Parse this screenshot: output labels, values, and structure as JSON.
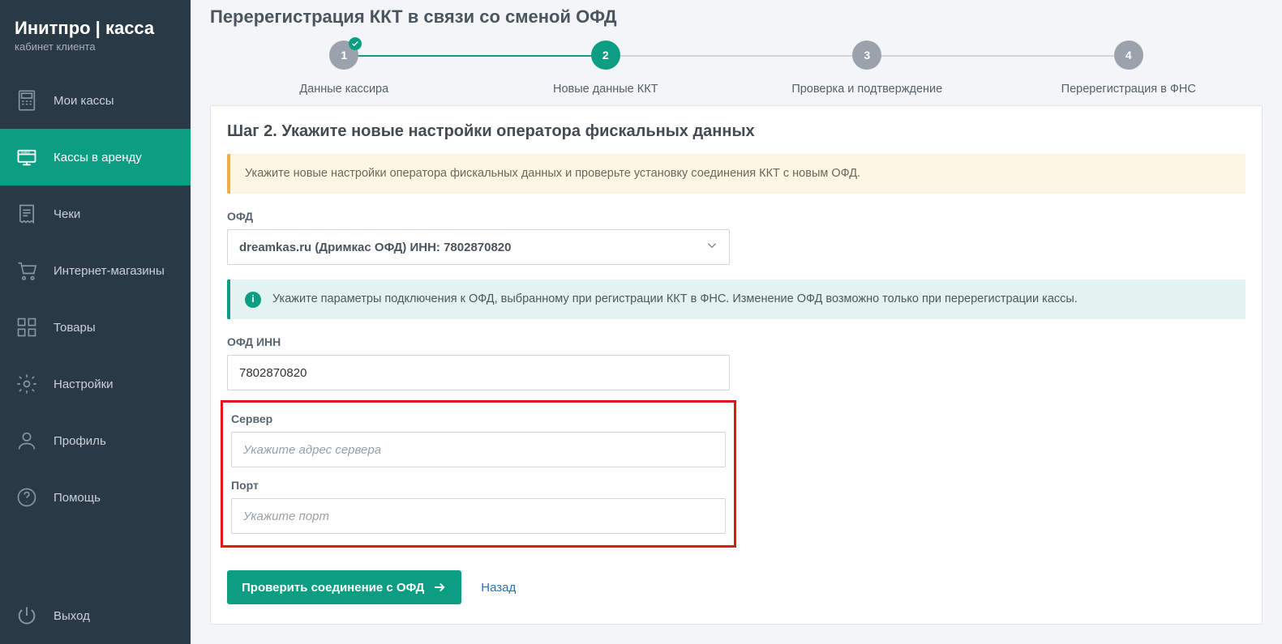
{
  "brand": {
    "title": "Инитпро | касса",
    "subtitle": "кабинет клиента"
  },
  "sidebar": {
    "items": [
      {
        "label": "Мои кассы"
      },
      {
        "label": "Кассы в аренду"
      },
      {
        "label": "Чеки"
      },
      {
        "label": "Интернет-магазины"
      },
      {
        "label": "Товары"
      },
      {
        "label": "Настройки"
      },
      {
        "label": "Профиль"
      },
      {
        "label": "Помощь"
      }
    ],
    "logout": "Выход"
  },
  "page": {
    "title": "Перерегистрация ККТ в связи со сменой ОФД",
    "steps": [
      {
        "num": "1",
        "label": "Данные кассира"
      },
      {
        "num": "2",
        "label": "Новые данные ККТ"
      },
      {
        "num": "3",
        "label": "Проверка и подтверждение"
      },
      {
        "num": "4",
        "label": "Перерегистрация в ФНС"
      }
    ],
    "card_title": "Шаг 2. Укажите новые настройки оператора фискальных данных",
    "warn_text": "Укажите новые настройки оператора фискальных данных и проверьте установку соединения ККТ с новым ОФД.",
    "info_text": "Укажите параметры подключения к ОФД, выбранному при регистрации ККТ в ФНС. Изменение ОФД возможно только при перерегистрации кассы.",
    "ofd_label": "ОФД",
    "ofd_value": "dreamkas.ru (Дримкас ОФД) ИНН: 7802870820",
    "inn_label": "ОФД ИНН",
    "inn_value": "7802870820",
    "server_label": "Сервер",
    "server_placeholder": "Укажите адрес сервера",
    "port_label": "Порт",
    "port_placeholder": "Укажите порт",
    "submit_label": "Проверить соединение с ОФД",
    "back_label": "Назад"
  }
}
